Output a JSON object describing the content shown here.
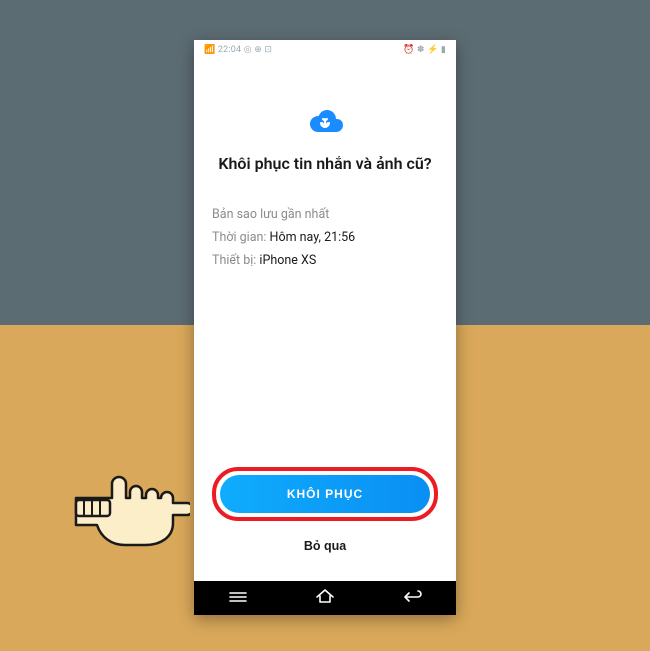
{
  "statusbar": {
    "time": "22:04",
    "indicator_left": "◎ ⊕ ⊡",
    "indicator_right": "⏰ ✽ ⚡ ▮"
  },
  "heading": "Khôi phục tin nhắn và ảnh cũ?",
  "backup": {
    "recent_label": "Bản sao lưu gần nhất",
    "time_label": "Thời gian:",
    "time_value": "Hôm nay, 21:56",
    "device_label": "Thiết bị:",
    "device_value": "iPhone XS"
  },
  "buttons": {
    "restore": "KHÔI PHỤC",
    "skip": "Bỏ qua"
  },
  "icons": {
    "cloud": "cloud-restore-icon",
    "nav_recents": "recents-icon",
    "nav_home": "home-icon",
    "nav_back": "back-icon"
  },
  "colors": {
    "accent": "#0a8ff3",
    "highlight": "#ec1c24"
  }
}
